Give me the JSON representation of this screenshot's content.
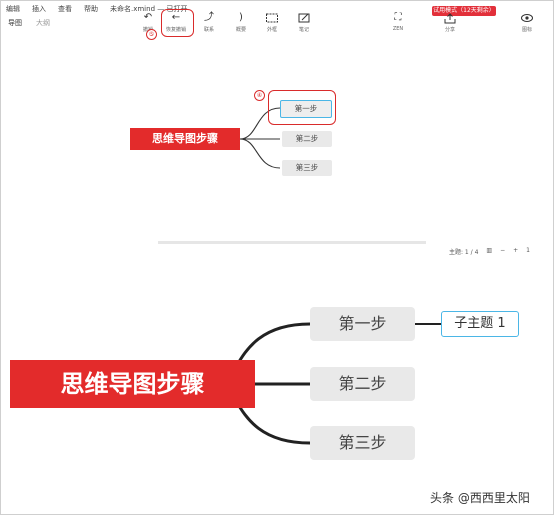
{
  "menu": {
    "items": [
      "编辑",
      "插入",
      "查看",
      "帮助"
    ],
    "doc_title": "未命名.xmind — 已打开"
  },
  "trial_badge": "试用模式（12天剩余）",
  "view_tabs": [
    {
      "label": "导图",
      "active": true
    },
    {
      "label": "大纲",
      "active": false
    }
  ],
  "toolbar": {
    "undo": "撤销",
    "redo": "恢复撤销",
    "link": "联系",
    "summary": "概要",
    "boundary": "外框",
    "note": "笔记",
    "zen": "ZEN",
    "share": "分享",
    "icon": "图标"
  },
  "callouts": {
    "toolbar": "⑤",
    "topic": "④"
  },
  "status": {
    "topic_count": "主题: 1 / 4",
    "zoom_minus": "−",
    "zoom_plus": "+",
    "zoom_value": "1"
  },
  "mindmap_small": {
    "root": "思维导图步骤",
    "topics": [
      "第一步",
      "第二步",
      "第三步"
    ]
  },
  "mindmap_large": {
    "root": "思维导图步骤",
    "topics": [
      "第一步",
      "第二步",
      "第三步"
    ],
    "subtopic": "子主题 1"
  },
  "watermark": "头条 @西西里太阳",
  "colors": {
    "root": "#e32b2b",
    "highlight": "#d92b2b",
    "selection": "#4bb6e6",
    "topic_bg": "#e9e9e9"
  }
}
